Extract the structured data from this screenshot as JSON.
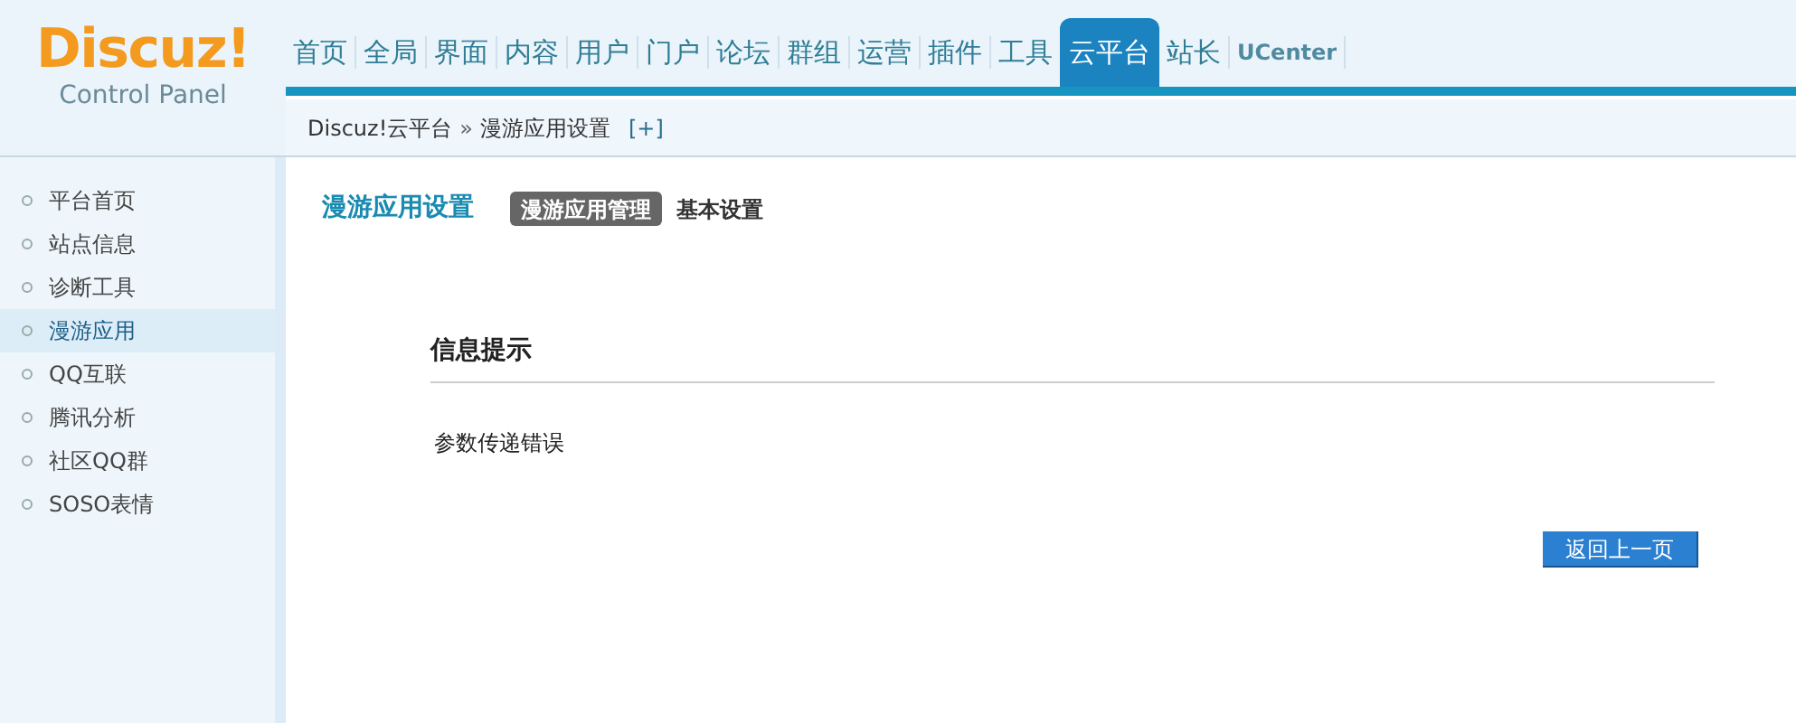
{
  "logo": {
    "title": "Discuz!",
    "subtitle": "Control Panel"
  },
  "nav": [
    {
      "label": "首页",
      "selected": false
    },
    {
      "label": "全局",
      "selected": false
    },
    {
      "label": "界面",
      "selected": false
    },
    {
      "label": "内容",
      "selected": false
    },
    {
      "label": "用户",
      "selected": false
    },
    {
      "label": "门户",
      "selected": false
    },
    {
      "label": "论坛",
      "selected": false
    },
    {
      "label": "群组",
      "selected": false
    },
    {
      "label": "运营",
      "selected": false
    },
    {
      "label": "插件",
      "selected": false
    },
    {
      "label": "工具",
      "selected": false
    },
    {
      "label": "云平台",
      "selected": true
    },
    {
      "label": "站长",
      "selected": false
    },
    {
      "label": "UCenter",
      "selected": false
    }
  ],
  "breadcrumb": {
    "root": "Discuz!云平台",
    "separator": "»",
    "current": "漫游应用设置",
    "toggle": "[+]"
  },
  "sidebar": {
    "items": [
      {
        "label": "平台首页",
        "selected": false
      },
      {
        "label": "站点信息",
        "selected": false
      },
      {
        "label": "诊断工具",
        "selected": false
      },
      {
        "label": "漫游应用",
        "selected": true
      },
      {
        "label": "QQ互联",
        "selected": false
      },
      {
        "label": "腾讯分析",
        "selected": false
      },
      {
        "label": "社区QQ群",
        "selected": false
      },
      {
        "label": "SOSO表情",
        "selected": false
      }
    ]
  },
  "page_title": "漫游应用设置",
  "tabs": [
    {
      "label": "漫游应用管理",
      "selected": true
    },
    {
      "label": "基本设置",
      "selected": false
    }
  ],
  "message": {
    "title": "信息提示",
    "text": "参数传递错误",
    "button": "返回上一页"
  }
}
